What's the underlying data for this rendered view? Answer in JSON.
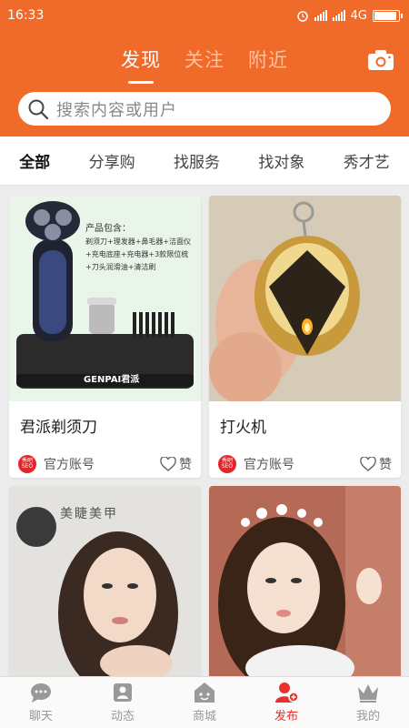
{
  "status": {
    "time": "16:33",
    "network": "4G"
  },
  "header": {
    "tabs": [
      {
        "label": "发现",
        "active": true
      },
      {
        "label": "关注"
      },
      {
        "label": "附近"
      }
    ],
    "camera_icon": "camera-icon"
  },
  "search": {
    "placeholder": "搜索内容或用户"
  },
  "categories": [
    "全部",
    "分享购",
    "找服务",
    "找对象",
    "秀才艺"
  ],
  "cards": [
    {
      "title": "君派剃须刀",
      "account": "官方账号",
      "like": "赞",
      "badge": "秀吧 SEO",
      "product_brand": "GENPAI君派",
      "product_text": [
        "产品包含：",
        "剃须刀+理发器+鼻毛器+洁面仪",
        "+充电底座+充电器+3款限位梳",
        "+刀头润滑油+清洁刷"
      ]
    },
    {
      "title": "打火机",
      "account": "官方账号",
      "like": "赞",
      "badge": "秀吧 SEO"
    },
    {
      "title": "",
      "account": "",
      "like": "",
      "badge": "",
      "photo_text": "美睫美甲"
    },
    {
      "title": "",
      "account": "",
      "like": "",
      "badge": ""
    }
  ],
  "bottom_nav": [
    {
      "label": "聊天",
      "icon": "chat-icon"
    },
    {
      "label": "动态",
      "icon": "feed-icon"
    },
    {
      "label": "商城",
      "icon": "shop-icon"
    },
    {
      "label": "发布",
      "icon": "publish-icon",
      "active": true
    },
    {
      "label": "我的",
      "icon": "crown-icon"
    }
  ],
  "colors": {
    "brand": "#f06a2a",
    "active_nav": "#e8312a",
    "badge": "#e3262c"
  }
}
